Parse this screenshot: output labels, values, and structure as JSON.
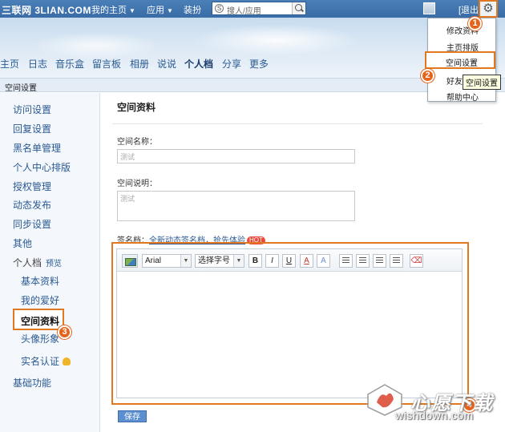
{
  "topbar": {
    "logo": "三联网 3LIAN.COM",
    "menu_home": "我的主页",
    "menu_apps": "应用",
    "menu_decorate": "装扮",
    "search_placeholder": "搜人/应用",
    "logout": "[退出]"
  },
  "nav": {
    "items": [
      "主页",
      "日志",
      "音乐盒",
      "留言板",
      "相册",
      "说说",
      "个人档",
      "分享",
      "更多"
    ],
    "active_index": 6
  },
  "breadcrumb": "空间设置",
  "sidebar": {
    "items": [
      "访问设置",
      "回复设置",
      "黑名单管理",
      "个人中心排版",
      "授权管理",
      "动态发布",
      "同步设置",
      "其他"
    ],
    "personal": "个人档",
    "preview": "预览",
    "sub_items": [
      "基本资料",
      "我的爱好",
      "空间资料",
      "头像形象",
      "实名认证"
    ],
    "selected_index": 2,
    "basic": "基础功能"
  },
  "main": {
    "title": "空间资料",
    "space_name_label": "空间名称：",
    "space_name_value": "测试",
    "space_desc_label": "空间说明：",
    "space_desc_value": "测试",
    "signature_label": "签名档：",
    "signature_link": "全新动态签名档，抢先体验",
    "hot": "HOT",
    "save": "保存"
  },
  "editor": {
    "font": "Arial",
    "size": "选择字号",
    "bold": "B",
    "italic": "I",
    "underline": "U",
    "font_color": "A",
    "bg_color": "A"
  },
  "dropdown": {
    "items": [
      "修改资料",
      "主页排版",
      "空间设置",
      "好友管理",
      "帮助中心"
    ],
    "highlight_index": 2,
    "tooltip": "空间设置"
  },
  "badges": [
    "1",
    "2",
    "3",
    "4"
  ],
  "watermark": {
    "name": "心愿下载",
    "url": "wishdown.com"
  },
  "colors": {
    "topbar": "#3a6ca6",
    "highlight": "#e1771f",
    "badge": "#e4641c",
    "link": "#2a5a93"
  }
}
